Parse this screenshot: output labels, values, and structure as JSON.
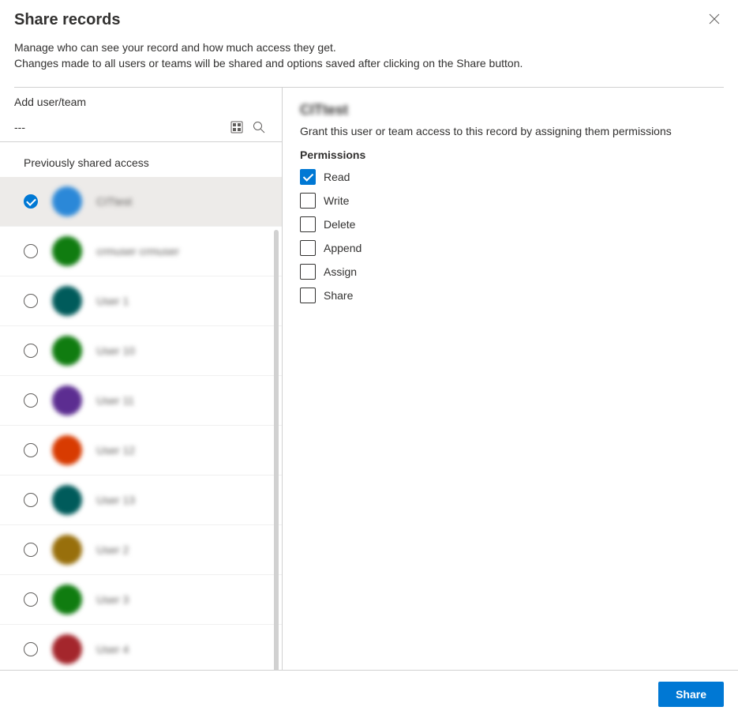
{
  "header": {
    "title": "Share records",
    "desc_line1": "Manage who can see your record and how much access they get.",
    "desc_line2": "Changes made to all users or teams will be shared and options saved after clicking on the Share button."
  },
  "left": {
    "add_label": "Add user/team",
    "search_value": "---",
    "subheader": "Previously shared access",
    "items": [
      {
        "label": "CITtest",
        "avatar_color": "#2b88d8",
        "selected": true
      },
      {
        "label": "crmuser crmuser",
        "avatar_color": "#107c10",
        "selected": false
      },
      {
        "label": "User 1",
        "avatar_color": "#005b5b",
        "selected": false
      },
      {
        "label": "User 10",
        "avatar_color": "#107c10",
        "selected": false
      },
      {
        "label": "User 11",
        "avatar_color": "#5c2d91",
        "selected": false
      },
      {
        "label": "User 12",
        "avatar_color": "#d83b01",
        "selected": false
      },
      {
        "label": "User 13",
        "avatar_color": "#005b5b",
        "selected": false
      },
      {
        "label": "User 2",
        "avatar_color": "#986f0b",
        "selected": false
      },
      {
        "label": "User 3",
        "avatar_color": "#107c10",
        "selected": false
      },
      {
        "label": "User 4",
        "avatar_color": "#a4262c",
        "selected": false
      }
    ]
  },
  "right": {
    "selected_name": "CITtest",
    "grant_text": "Grant this user or team access to this record by assigning them permissions",
    "perm_header": "Permissions",
    "permissions": [
      {
        "label": "Read",
        "checked": true
      },
      {
        "label": "Write",
        "checked": false
      },
      {
        "label": "Delete",
        "checked": false
      },
      {
        "label": "Append",
        "checked": false
      },
      {
        "label": "Assign",
        "checked": false
      },
      {
        "label": "Share",
        "checked": false
      }
    ]
  },
  "footer": {
    "share_label": "Share"
  }
}
